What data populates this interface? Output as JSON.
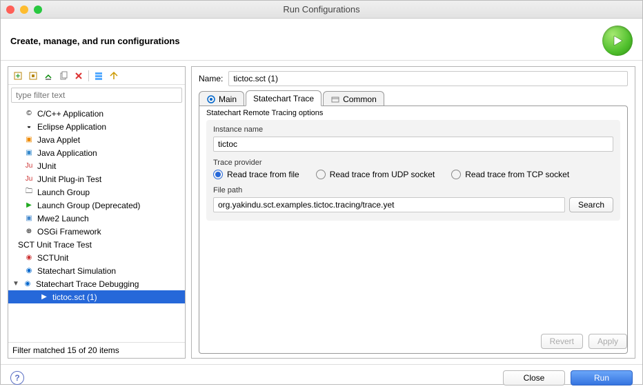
{
  "window_title": "Run Configurations",
  "header_title": "Create, manage, and run configurations",
  "filter_placeholder": "type filter text",
  "tree_items": [
    {
      "label": "C/C++ Application"
    },
    {
      "label": "Eclipse Application"
    },
    {
      "label": "Java Applet"
    },
    {
      "label": "Java Application"
    },
    {
      "label": "JUnit"
    },
    {
      "label": "JUnit Plug-in Test"
    },
    {
      "label": "Launch Group"
    },
    {
      "label": "Launch Group (Deprecated)"
    },
    {
      "label": "Mwe2 Launch"
    },
    {
      "label": "OSGi Framework"
    }
  ],
  "tree_sct": "SCT Unit Trace Test",
  "tree_sctunit": "SCTUnit",
  "tree_sim": "Statechart Simulation",
  "tree_debug": "Statechart Trace Debugging",
  "tree_selected": "tictoc.sct (1)",
  "filter_count": "Filter matched 15 of 20 items",
  "name_label": "Name:",
  "name_value": "tictoc.sct (1)",
  "tabs": {
    "main": "Main",
    "trace": "Statechart Trace",
    "common": "Common"
  },
  "group_title": "Statechart Remote Tracing options",
  "instance_label": "Instance name",
  "instance_value": "tictoc",
  "provider_label": "Trace provider",
  "radio_file": "Read trace from file",
  "radio_udp": "Read trace from UDP socket",
  "radio_tcp": "Read trace from TCP socket",
  "filepath_label": "File path",
  "filepath_value": "org.yakindu.sct.examples.tictoc.tracing/trace.yet",
  "search_label": "Search",
  "revert_label": "Revert",
  "apply_label": "Apply",
  "close_label": "Close",
  "run_label": "Run"
}
